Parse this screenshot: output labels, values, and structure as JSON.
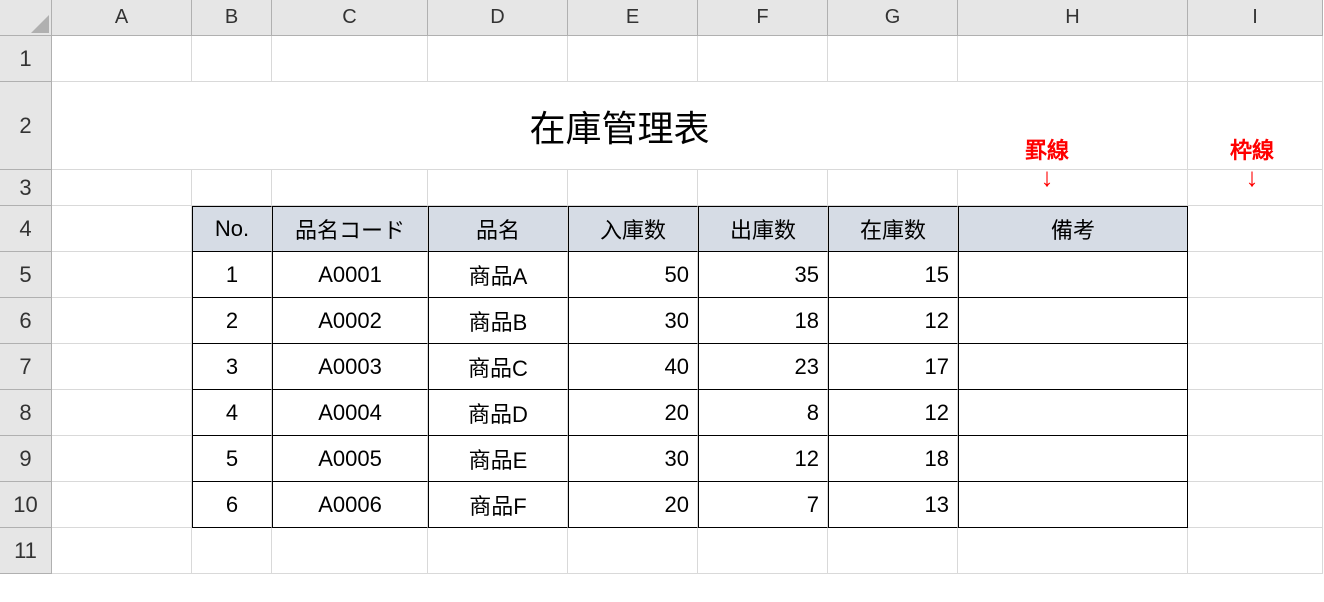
{
  "columns": [
    "A",
    "B",
    "C",
    "D",
    "E",
    "F",
    "G",
    "H",
    "I"
  ],
  "rows": [
    "1",
    "2",
    "3",
    "4",
    "5",
    "6",
    "7",
    "8",
    "9",
    "10",
    "11"
  ],
  "title": "在庫管理表",
  "table": {
    "headers": [
      "No.",
      "品名コード",
      "品名",
      "入庫数",
      "出庫数",
      "在庫数",
      "備考"
    ],
    "data": [
      {
        "no": "1",
        "code": "A0001",
        "name": "商品A",
        "in": "50",
        "out": "35",
        "stock": "15",
        "note": ""
      },
      {
        "no": "2",
        "code": "A0002",
        "name": "商品B",
        "in": "30",
        "out": "18",
        "stock": "12",
        "note": ""
      },
      {
        "no": "3",
        "code": "A0003",
        "name": "商品C",
        "in": "40",
        "out": "23",
        "stock": "17",
        "note": ""
      },
      {
        "no": "4",
        "code": "A0004",
        "name": "商品D",
        "in": "20",
        "out": "8",
        "stock": "12",
        "note": ""
      },
      {
        "no": "5",
        "code": "A0005",
        "name": "商品E",
        "in": "30",
        "out": "12",
        "stock": "18",
        "note": ""
      },
      {
        "no": "6",
        "code": "A0006",
        "name": "商品F",
        "in": "20",
        "out": "7",
        "stock": "13",
        "note": ""
      }
    ]
  },
  "annotations": {
    "keisen": "罫線",
    "wakusen": "枠線"
  }
}
